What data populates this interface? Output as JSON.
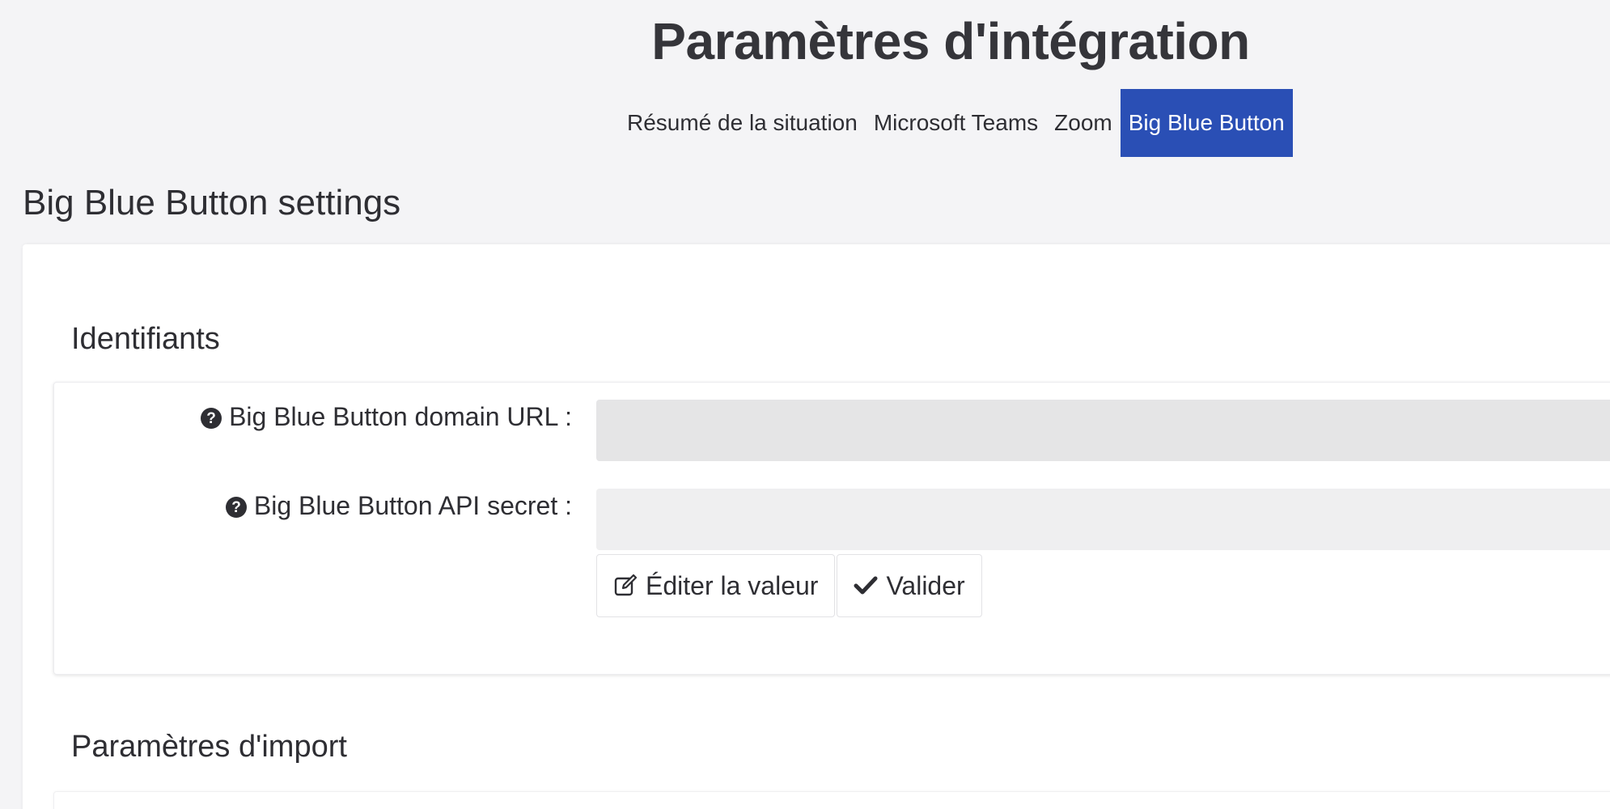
{
  "page": {
    "title": "Paramètres d'intégration"
  },
  "tabs": [
    {
      "label": "Résumé de la situation",
      "active": false
    },
    {
      "label": "Microsoft Teams",
      "active": false
    },
    {
      "label": "Zoom",
      "active": false
    },
    {
      "label": "Big Blue Button",
      "active": true
    }
  ],
  "section": {
    "title": "Big Blue Button settings"
  },
  "credentials": {
    "title": "Identifiants",
    "domain_url": {
      "label": "Big Blue Button domain URL :",
      "value": "",
      "icon": "question-circle-icon"
    },
    "api_secret": {
      "label": "Big Blue Button API secret :",
      "value": "",
      "icon": "question-circle-icon"
    },
    "edit_button": {
      "label": "Éditer la valeur",
      "icon": "edit-icon"
    },
    "validate_button": {
      "label": "Valider",
      "icon": "check-icon"
    }
  },
  "import_settings": {
    "title": "Paramètres d'import"
  },
  "colors": {
    "accent": "#2a4fb5",
    "background": "#f4f4f6",
    "input_background": "#e6e6e7"
  }
}
